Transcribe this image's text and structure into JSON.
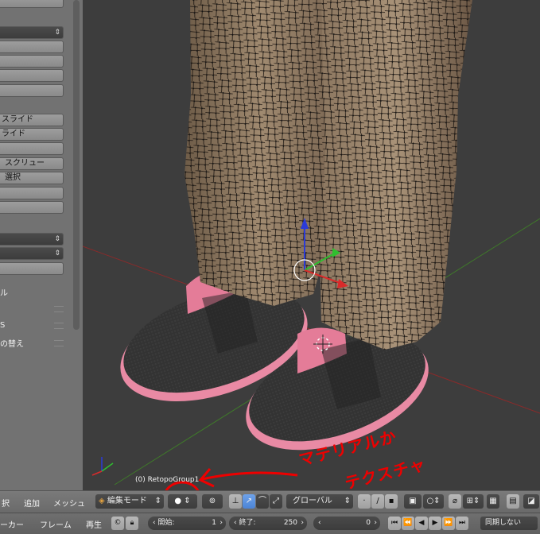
{
  "left_panel": {
    "items": [
      {
        "label": ""
      },
      {
        "label": ""
      },
      {
        "label": ""
      },
      {
        "label": ""
      },
      {
        "label": ""
      },
      {
        "label": ""
      },
      {
        "label": "スライド"
      },
      {
        "label": "ライド"
      },
      {
        "label": ""
      },
      {
        "label": "スクリュー"
      },
      {
        "label": "選択"
      },
      {
        "label": ""
      },
      {
        "label": ""
      }
    ],
    "labels": [
      "ル",
      "S",
      "の替え"
    ]
  },
  "viewport": {
    "object_label": "(0) RetopoGroup1",
    "annotation_line1": "マテリアルか",
    "annotation_line2": "テクスチャ"
  },
  "header": {
    "menu_select": "択",
    "menu_add": "追加",
    "menu_mesh": "メッシュ",
    "mode": "編集モード",
    "orientation": "グローバル"
  },
  "timeline": {
    "marker": "ーカー",
    "frame": "フレーム",
    "playback": "再生",
    "start_label": "開始:",
    "start_value": "1",
    "end_label": "終了:",
    "end_value": "250",
    "current_value": "0",
    "sync": "同期しない"
  },
  "colors": {
    "accent": "#5b8fe0",
    "annotation": "#ee0000"
  }
}
